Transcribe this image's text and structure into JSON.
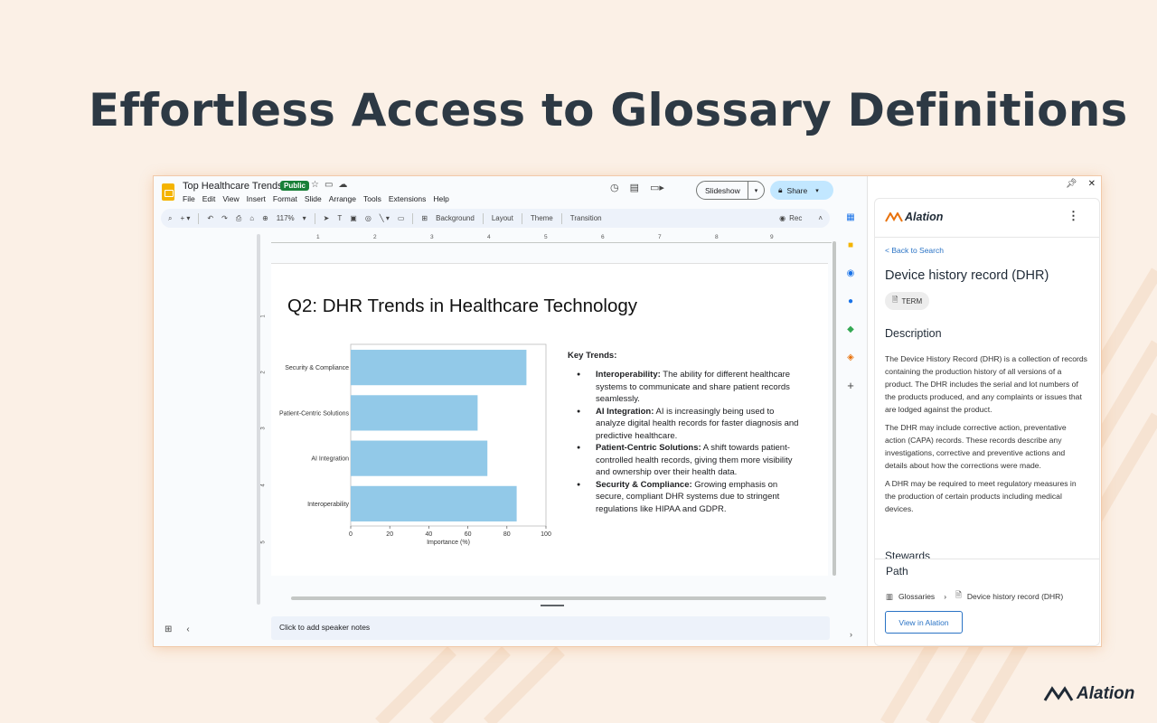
{
  "hero": {
    "title": "Effortless Access to Glossary Definitions"
  },
  "slides_app": {
    "doc_title": "Top Healthcare Trends",
    "badge": "Public",
    "menu": [
      "File",
      "Edit",
      "View",
      "Insert",
      "Format",
      "Slide",
      "Arrange",
      "Tools",
      "Extensions",
      "Help"
    ],
    "slideshow_label": "Slideshow",
    "share_label": "Share",
    "zoom": "117%",
    "toolbar": {
      "background": "Background",
      "layout": "Layout",
      "theme": "Theme",
      "transition": "Transition",
      "rec": "Rec"
    },
    "ruler_marks": [
      "1",
      "2",
      "3",
      "4",
      "5",
      "6",
      "7",
      "8",
      "9"
    ],
    "vruler_marks": [
      "1",
      "2",
      "3",
      "4",
      "5"
    ],
    "notes_placeholder": "Click to add speaker notes"
  },
  "slide": {
    "title": "Q2: DHR Trends in Healthcare Technology",
    "key_trends_title": "Key Trends:",
    "trends": [
      {
        "term": "Interoperability:",
        "text": " The ability for different healthcare systems to communicate and share patient records seamlessly."
      },
      {
        "term": "AI Integration:",
        "text": " AI is increasingly being used to analyze digital health records for faster diagnosis and predictive healthcare."
      },
      {
        "term": "Patient-Centric Solutions:",
        "text": " A shift towards patient-controlled health records, giving them more visibility and ownership over their health data."
      },
      {
        "term": "Security & Compliance:",
        "text": " Growing emphasis on secure, compliant DHR systems due to stringent regulations like HIPAA and GDPR."
      }
    ]
  },
  "chart_data": {
    "type": "bar",
    "orientation": "horizontal",
    "categories": [
      "Security & Compliance",
      "Patient-Centric Solutions",
      "AI Integration",
      "Interoperability"
    ],
    "values": [
      90,
      65,
      70,
      85
    ],
    "xlabel": "Importance (%)",
    "ylabel": "",
    "xlim": [
      0,
      100
    ],
    "xticks": [
      0,
      20,
      40,
      60,
      80,
      100
    ],
    "bar_color": "#92c9e8",
    "grid": false
  },
  "alation": {
    "brand": "Alation",
    "back_link": "< Back to Search",
    "term_name": "Device history record (DHR)",
    "badge": "TERM",
    "description_title": "Description",
    "description": [
      "The Device History Record (DHR) is a collection of records containing the production history of all versions of a product. The DHR includes the serial and lot numbers of the products produced, and any complaints or issues that are lodged against the product.",
      "The DHR may include corrective action, preventative action (CAPA) records. These records describe any investigations, corrective and preventive actions and details about how the corrections were made.",
      "A DHR may be required to meet regulatory measures in the production of certain products including medical devices."
    ],
    "stewards_title": "Stewards",
    "path_title": "Path",
    "path": [
      "Glossaries",
      "Device history record (DHR)"
    ],
    "view_button": "View in Alation"
  },
  "footer": {
    "brand": "Alation"
  },
  "colors": {
    "background": "#fbf0e6",
    "accent": "#2a73c5",
    "share": "#c2e7ff",
    "public": "#188038"
  }
}
